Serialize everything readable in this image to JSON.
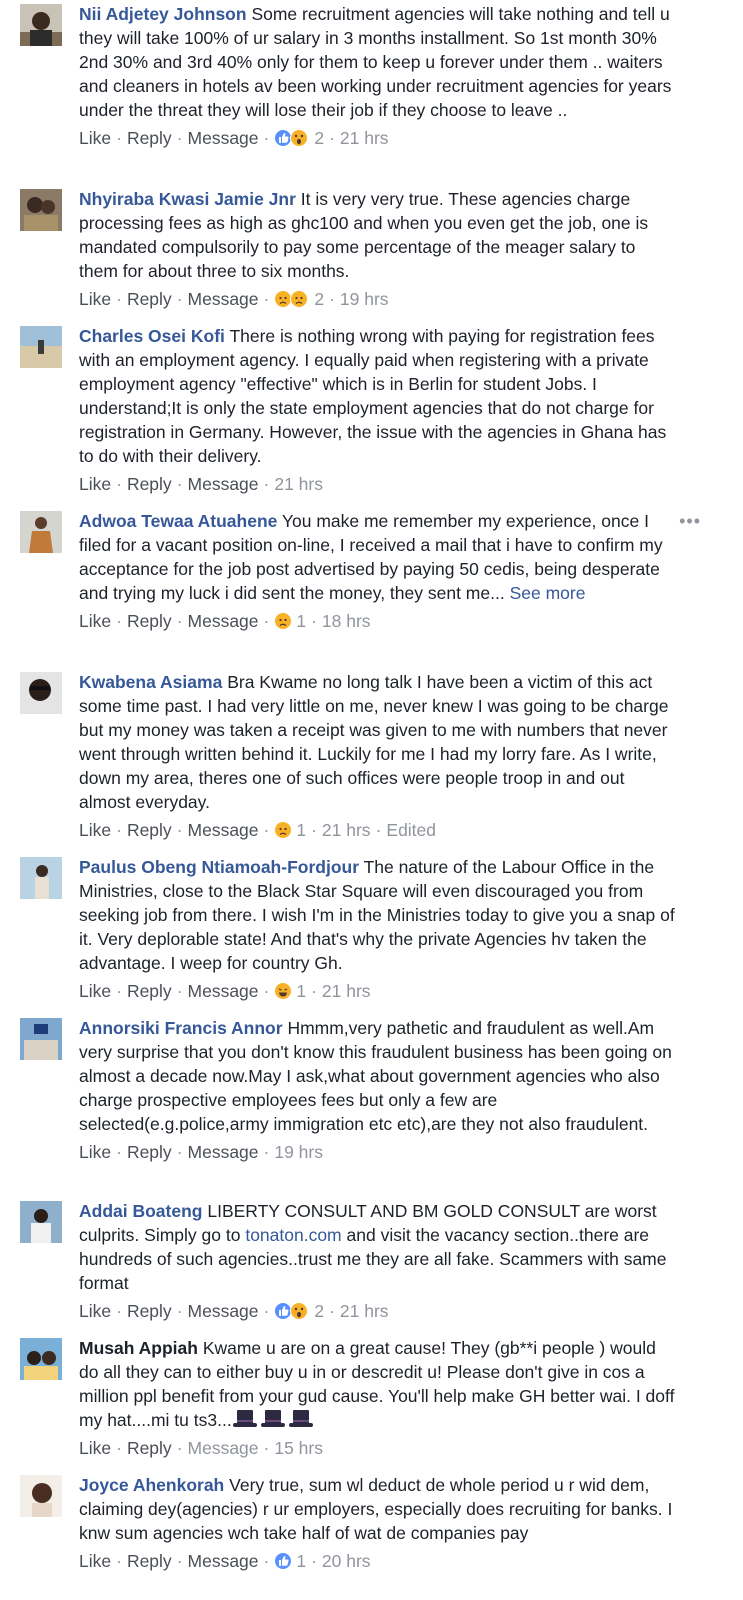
{
  "comments": [
    {
      "author": "Nii Adjetey Johnson",
      "text": "Some recruitment agencies will take nothing and tell u they will take 100% of ur salary in 3 months installment. So 1st month 30% 2nd 30% and 3rd 40% only for them to keep u forever under them .. waiters and cleaners in hotels av been working under recruitment agencies for years under the threat they will lose their job if they choose to leave ..",
      "like": "Like",
      "reply": "Reply",
      "message": "Message",
      "reactions": [
        "like",
        "wow"
      ],
      "count": "2",
      "time": "21 hrs"
    },
    {
      "author": "Nhyiraba Kwasi Jamie Jnr",
      "text": "It is very very true. These agencies charge processing fees as high as ghc100 and when you even get the job, one is mandated compulsorily to pay some percentage of the meager salary to them for about three to six months.",
      "like": "Like",
      "reply": "Reply",
      "message": "Message",
      "reactions": [
        "sad",
        "sad"
      ],
      "count": "2",
      "time": "19 hrs"
    },
    {
      "author": "Charles Osei Kofi",
      "text": "There is nothing wrong with paying for registration fees with an employment agency. I equally paid when registering with a private employment agency \"effective\" which is in Berlin for student Jobs. I understand;It is only the state employment agencies that do not charge for registration in Germany. However, the issue with the agencies in Ghana has to do with their delivery.",
      "like": "Like",
      "reply": "Reply",
      "message": "Message",
      "time": "21 hrs"
    },
    {
      "author": "Adwoa Tewaa Atuahene",
      "text": "You make me remember my experience, once I filed for a vacant position on-line, I received a mail that i have to confirm my acceptance for the job post advertised by paying 50 cedis, being desperate and trying my luck i did sent the money, they sent me...",
      "see_more": "See more",
      "like": "Like",
      "reply": "Reply",
      "message": "Message",
      "reactions": [
        "sad"
      ],
      "count": "1",
      "time": "18 hrs"
    },
    {
      "author": "Kwabena Asiama",
      "text": "Bra Kwame no long talk I have been a victim of this act some time past. I had very little on me, never knew I was going to be charge but my money was taken a receipt was given to me with numbers that never went through written behind it. Luckily for me I had my lorry fare. As I write, down my area, theres one of such offices were people troop in and out almost everyday.",
      "like": "Like",
      "reply": "Reply",
      "message": "Message",
      "reactions": [
        "sad"
      ],
      "count": "1",
      "time": "21 hrs",
      "edited": "Edited"
    },
    {
      "author": "Paulus Obeng Ntiamoah-Fordjour",
      "text": "The nature of the Labour Office in the Ministries, close to the Black Star Square will even discouraged you from seeking job from there. I wish I'm in the Ministries today to give you a snap of it. Very deplorable state! And that's why the private Agencies hv taken the advantage. I weep for country Gh.",
      "like": "Like",
      "reply": "Reply",
      "message": "Message",
      "reactions": [
        "haha"
      ],
      "count": "1",
      "time": "21 hrs"
    },
    {
      "author": "Annorsiki Francis Annor",
      "text": "Hmmm,very pathetic and fraudulent as well.Am very surprise that you don't know this fraudulent business has been going on almost a decade now.May I ask,what about government agencies who also charge prospective employees fees but only a few are selected(e.g.police,army immigration etc etc),are they not also fraudulent.",
      "like": "Like",
      "reply": "Reply",
      "message": "Message",
      "time": "19 hrs"
    },
    {
      "author": "Addai Boateng",
      "text_before": "LIBERTY CONSULT AND BM GOLD CONSULT are worst culprits. Simply go to",
      "link": "tonaton.com",
      "text_after": "and visit the vacancy section..there are hundreds of such agencies..trust me they are all fake. Scammers with same format",
      "like": "Like",
      "reply": "Reply",
      "message": "Message",
      "reactions": [
        "like",
        "wow"
      ],
      "count": "2",
      "time": "21 hrs"
    },
    {
      "author": "Musah Appiah",
      "text": "Kwame u are on a great cause! They (gb**i people ) would do all they can to either buy u in or descredit u! Please don't give in cos a million ppl benefit from your gud cause. You'll help make GH better wai. I doff my hat....mi tu ts3...",
      "emoji": "top-hat",
      "like": "Like",
      "reply": "Reply",
      "message": "Message",
      "time": "15 hrs"
    },
    {
      "author": "Joyce Ahenkorah",
      "text": "Very true, sum wl deduct de whole period u r wid dem, claiming dey(agencies) r ur employers, especially does recruiting for banks. I knw sum agencies wch take half of wat de companies pay",
      "like": "Like",
      "reply": "Reply",
      "message": "Message",
      "reactions": [
        "like"
      ],
      "count": "1",
      "time": "20 hrs"
    }
  ],
  "colors": {
    "link": "#365899",
    "meta": "#90949c",
    "text": "#1d2129",
    "like": "#5890ff",
    "emoji": "#f7b125"
  }
}
